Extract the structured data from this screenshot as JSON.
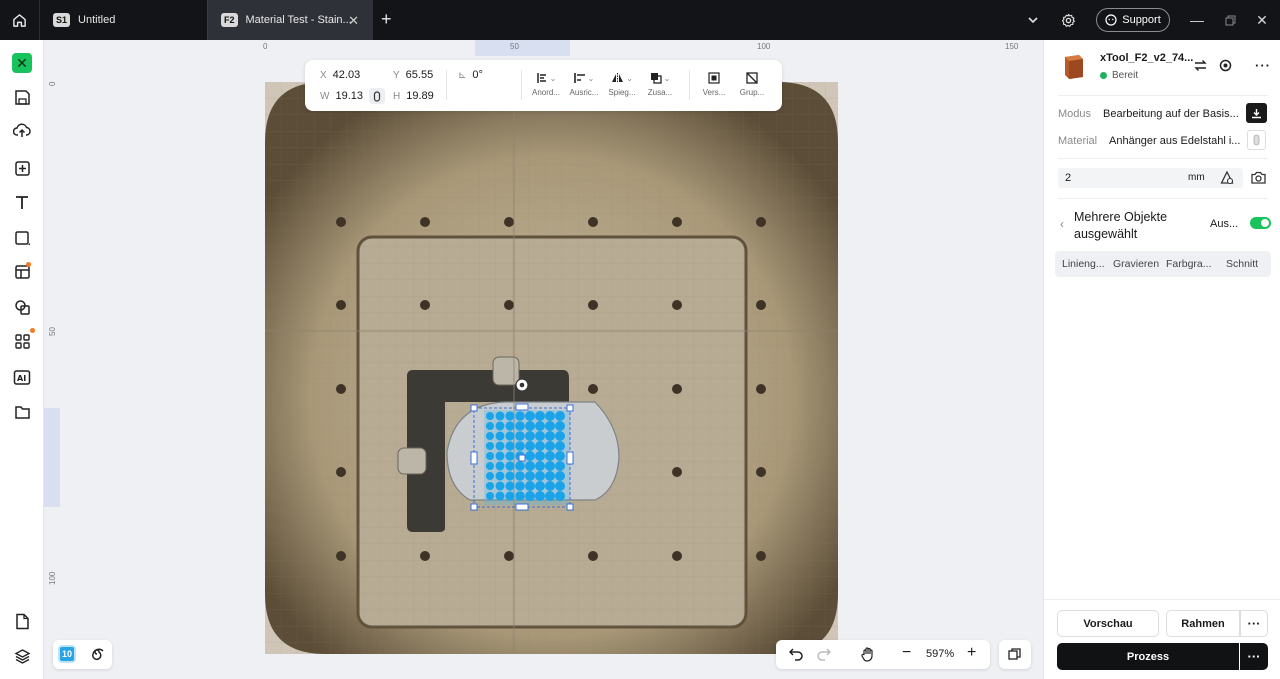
{
  "tabs": [
    {
      "badge": "S1",
      "title": "Untitled"
    },
    {
      "badge": "F2",
      "title": "Material Test - Stain..."
    }
  ],
  "topbar": {
    "support_label": "Support"
  },
  "ruler": {
    "top_ticks": [
      "0",
      "50",
      "100",
      "150"
    ],
    "left_ticks": [
      "0",
      "50",
      "100"
    ]
  },
  "toolbar": {
    "x_label": "X",
    "x_value": "42.03",
    "y_label": "Y",
    "y_value": "65.55",
    "w_label": "W",
    "w_value": "19.13",
    "h_label": "H",
    "h_value": "19.89",
    "rotation": "0°",
    "arrange_label": "Anord...",
    "align_label": "Ausric...",
    "mirror_label": "Spieg...",
    "combine_label": "Zusa...",
    "offset_label": "Vers...",
    "group_label": "Grup..."
  },
  "device": {
    "name": "xTool_F2_v2_74...",
    "status": "Bereit",
    "status_color": "#22b15a"
  },
  "settings": {
    "mode_label": "Modus",
    "mode_value": "Bearbeitung auf der Basis...",
    "material_label": "Material",
    "material_value": "Anhänger aus Edelstahl i...",
    "thickness_value": "2",
    "thickness_unit": "mm"
  },
  "selection": {
    "title_line1": "Mehrere Objekte",
    "title_line2": "ausgewählt",
    "output_label": "Aus...",
    "output_enabled": true
  },
  "process_tabs": [
    "Linieng...",
    "Gravieren",
    "Farbgra...",
    "Schnitt"
  ],
  "footer": {
    "preview_label": "Vorschau",
    "frame_label": "Rahmen",
    "process_label": "Prozess"
  },
  "zoom": {
    "value": "597%"
  },
  "bottom_left": {
    "layer_badge": "10"
  },
  "accent": "#18c25c",
  "selection_color": "#1aa3e8"
}
